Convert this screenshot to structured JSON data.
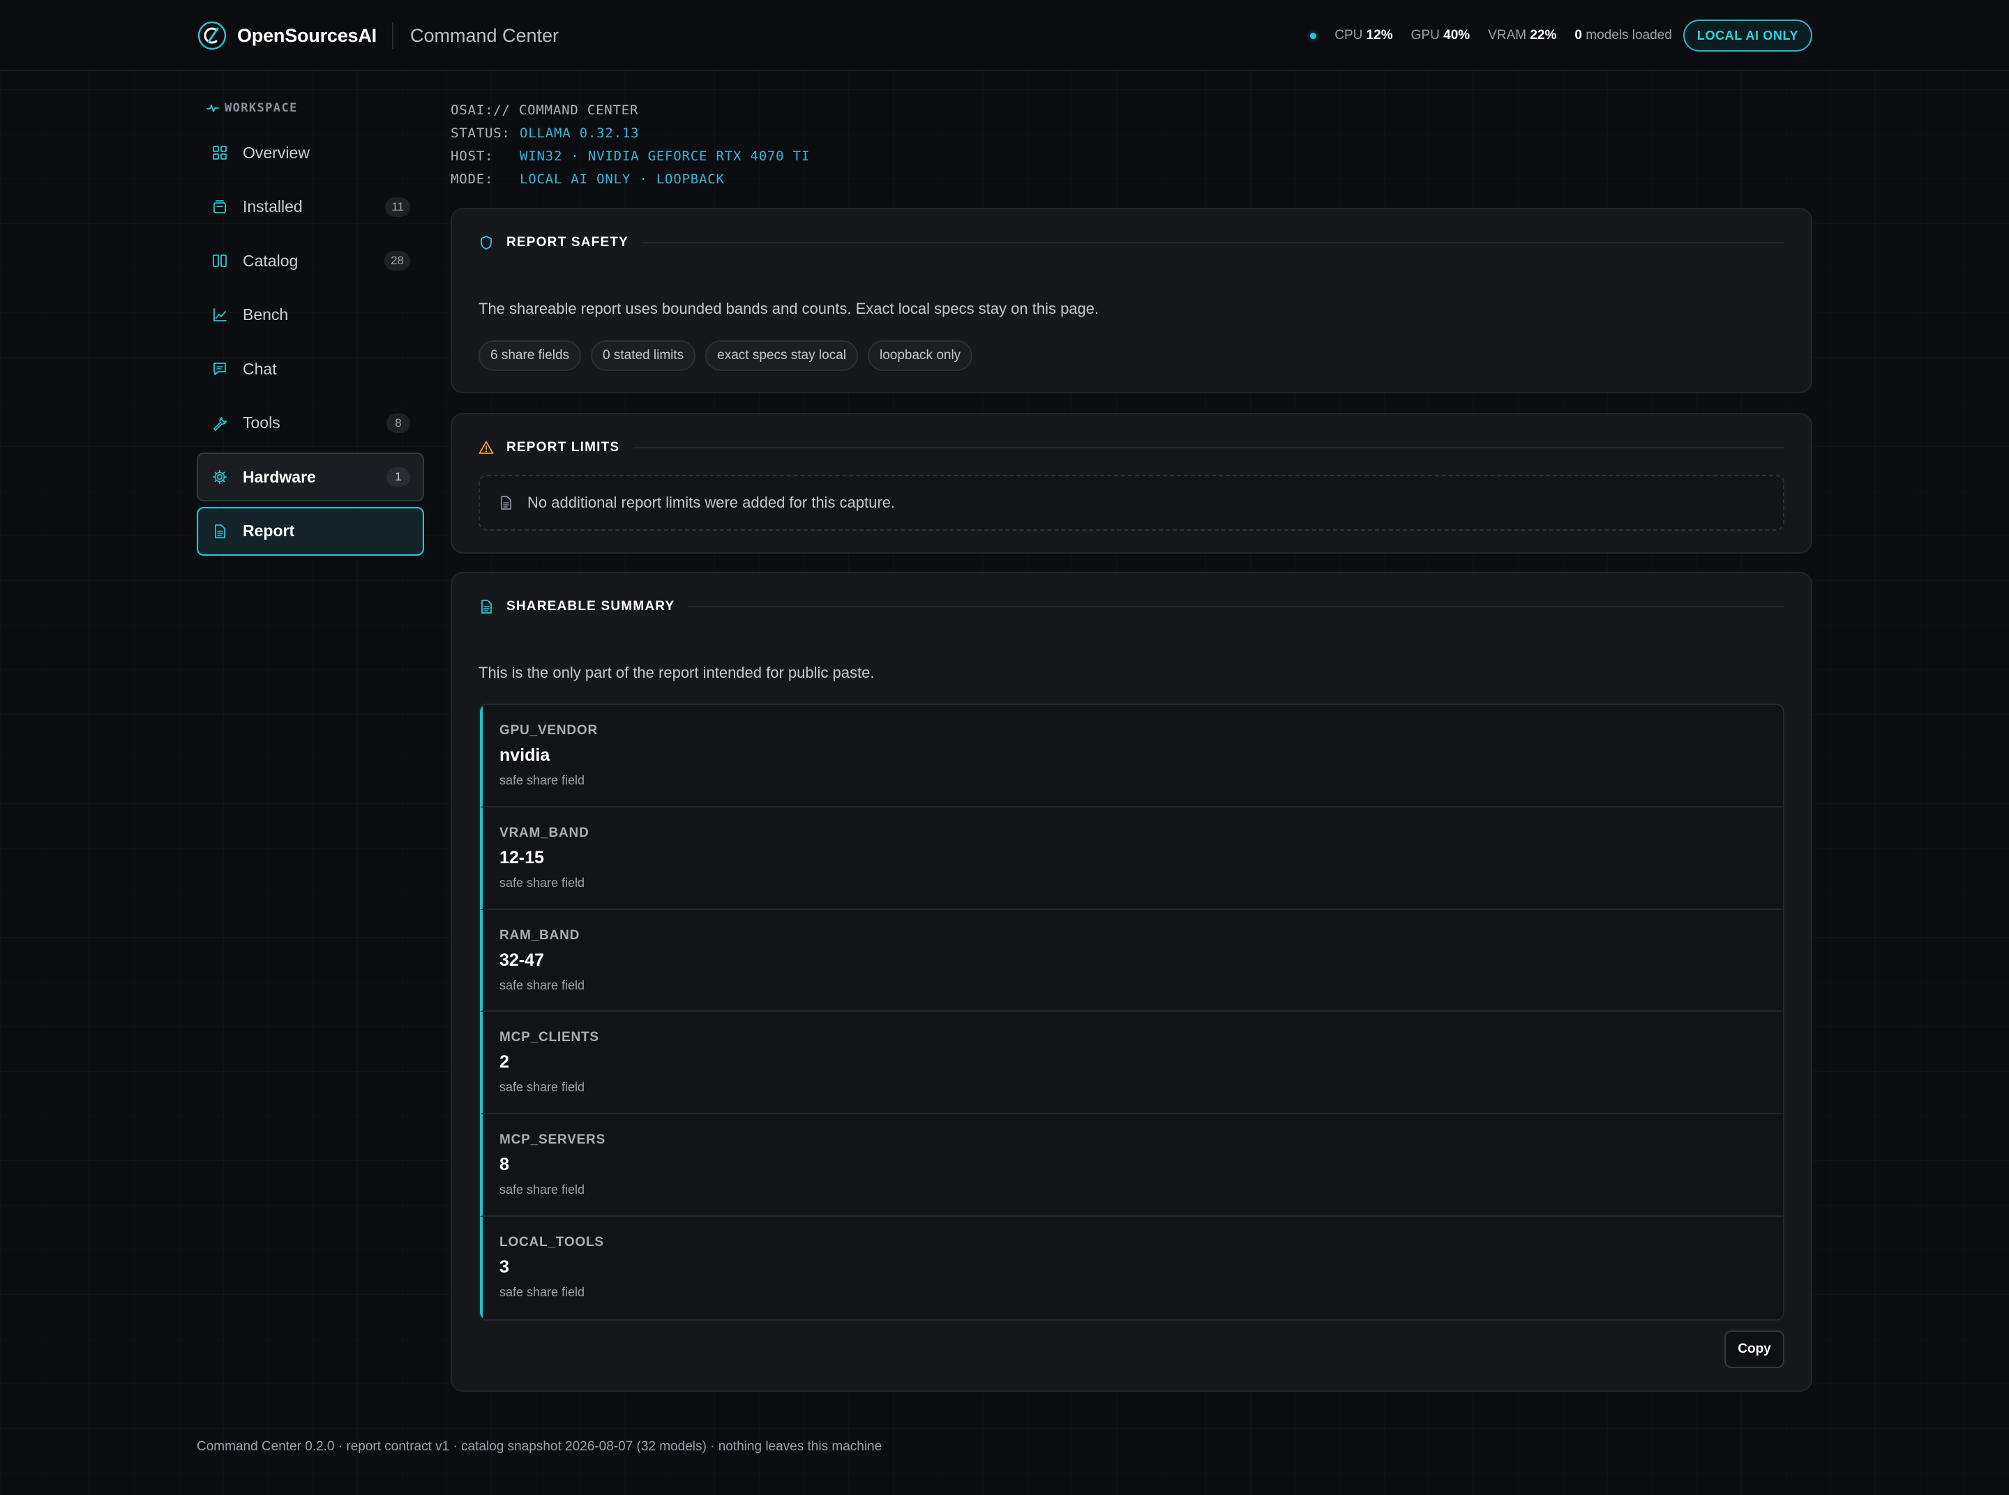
{
  "brand": {
    "name": "OpenSourcesAI",
    "subtitle": "Command Center"
  },
  "stats": {
    "cpu_label": "CPU",
    "cpu_value": "12%",
    "gpu_label": "GPU",
    "gpu_value": "40%",
    "vram_label": "VRAM",
    "vram_value": "22%",
    "models_value": "0",
    "models_label": "models loaded",
    "mode_pill": "LOCAL AI ONLY"
  },
  "sidebar": {
    "section_label": "WORKSPACE",
    "items": [
      {
        "label": "Overview",
        "icon": "grid-icon"
      },
      {
        "label": "Installed",
        "icon": "package-icon",
        "badge": "11"
      },
      {
        "label": "Catalog",
        "icon": "book-icon",
        "badge": "28"
      },
      {
        "label": "Bench",
        "icon": "chart-icon"
      },
      {
        "label": "Chat",
        "icon": "chat-icon"
      },
      {
        "label": "Tools",
        "icon": "wrench-icon",
        "badge": "8"
      },
      {
        "label": "Hardware",
        "icon": "gear-icon",
        "badge": "1"
      },
      {
        "label": "Report",
        "icon": "document-icon",
        "active": true
      }
    ]
  },
  "terminal": {
    "line1": "OSAI:// COMMAND CENTER",
    "status_key": "STATUS:",
    "status_value": "OLLAMA 0.32.13",
    "host_key": "HOST:",
    "host_value": "WIN32 · NVIDIA GEFORCE RTX 4070 TI",
    "mode_key": "MODE:",
    "mode_value": "LOCAL AI ONLY · LOOPBACK"
  },
  "report_safety": {
    "title": "REPORT SAFETY",
    "description": "The shareable report uses bounded bands and counts. Exact local specs stay on this page.",
    "chips": [
      "6 share fields",
      "0 stated limits",
      "exact specs stay local",
      "loopback only"
    ]
  },
  "report_limits": {
    "title": "REPORT LIMITS",
    "empty_message": "No additional report limits were added for this capture."
  },
  "shareable_summary": {
    "title": "SHAREABLE SUMMARY",
    "description": "This is the only part of the report intended for public paste.",
    "fields": [
      {
        "key": "GPU_VENDOR",
        "value": "nvidia",
        "note": "safe share field"
      },
      {
        "key": "VRAM_BAND",
        "value": "12-15",
        "note": "safe share field"
      },
      {
        "key": "RAM_BAND",
        "value": "32-47",
        "note": "safe share field"
      },
      {
        "key": "MCP_CLIENTS",
        "value": "2",
        "note": "safe share field"
      },
      {
        "key": "MCP_SERVERS",
        "value": "8",
        "note": "safe share field"
      },
      {
        "key": "LOCAL_TOOLS",
        "value": "3",
        "note": "safe share field"
      }
    ],
    "copy_label": "Copy"
  },
  "footer": {
    "text": "Command Center 0.2.0 · report contract v1 · catalog snapshot 2026-08-07 (32 models) · nothing leaves this machine"
  },
  "colors": {
    "accent": "#22c0cf",
    "warning": "#e8a23a",
    "background": "#0c0d10",
    "card": "#17181c"
  }
}
